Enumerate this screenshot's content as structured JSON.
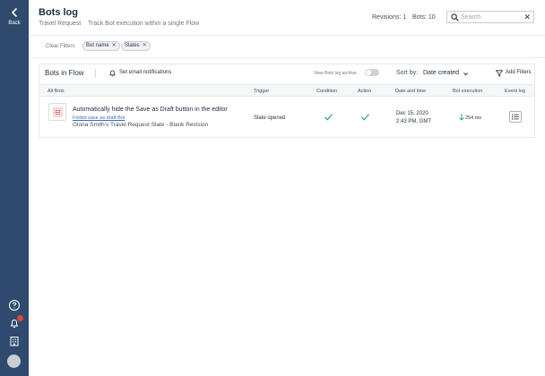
{
  "sidebar": {
    "back_label": "Back",
    "icons": [
      "help-icon",
      "bell-icon",
      "building-icon"
    ],
    "color": "#2f4a6d"
  },
  "header": {
    "title": "Bots log",
    "flow_name": "Travel Request",
    "description": "Track Bot execution within a single Flow",
    "revisions": "Revisions: 1",
    "bots_count": "Bots: 10",
    "search_placeholder": "Search"
  },
  "filters": {
    "clear_label": "Clear Filters",
    "chips": [
      "Bot name",
      "Slates"
    ]
  },
  "card": {
    "title": "Bots in Flow",
    "email_notifications": "Set email notifications",
    "archive_label": "View Bots log archive",
    "archive_on": false,
    "sort_label": "Sort by:",
    "sort_value": "Date created",
    "add_filters": "Add Filters",
    "columns": [
      "All Bots",
      "Trigger",
      "Condition",
      "Action",
      "Date and time",
      "Bot execution",
      "Event log"
    ],
    "rows": [
      {
        "name": "Automatically hide the Save as Draft button in the editor",
        "link": "Forbid save as draft Bot",
        "slate": "Gloria Smith's Travel Request Slate - Blank Revision",
        "trigger": "Slate opened",
        "condition": "check",
        "action": "check",
        "date": "Dec 15, 2020",
        "time": "2:43 PM, GMT",
        "execution": "254 ms"
      }
    ]
  },
  "colors": {
    "accent": "#2f4a6d",
    "success": "#2aa876",
    "notification": "#e0453b",
    "link": "#3b6fb6"
  }
}
